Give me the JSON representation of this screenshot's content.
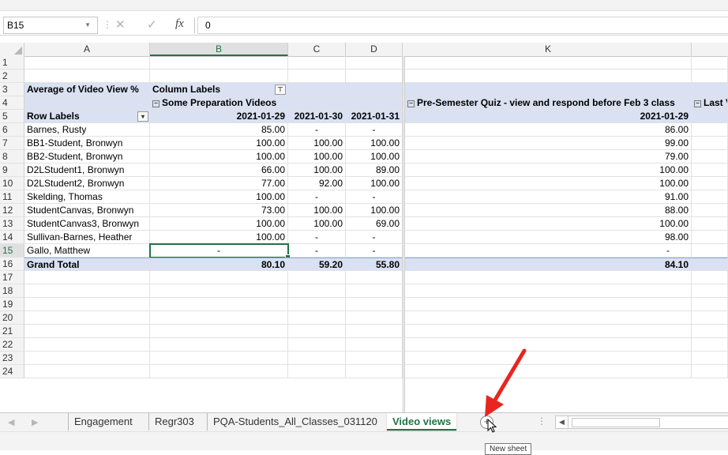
{
  "formula_bar": {
    "name_box": "B15",
    "fx_label": "fx",
    "formula_value": "0"
  },
  "columns": [
    "A",
    "B",
    "C",
    "D",
    "K"
  ],
  "row_numbers": [
    "1",
    "2",
    "3",
    "4",
    "5",
    "6",
    "7",
    "8",
    "9",
    "10",
    "11",
    "12",
    "13",
    "14",
    "15",
    "16",
    "17",
    "18",
    "19",
    "20",
    "21",
    "22",
    "23",
    "24"
  ],
  "pivot": {
    "title": "Average of Video View %",
    "column_labels": "Column Labels",
    "group1": "Some Preparation Videos",
    "group2": "Pre-Semester Quiz - view and respond before Feb 3 class",
    "group3_partial": "Last V",
    "row_labels": "Row Labels",
    "dates": [
      "2021-01-29",
      "2021-01-30",
      "2021-01-31",
      "2021-01-29"
    ],
    "rows": [
      {
        "name": "Barnes, Rusty",
        "b": "85.00",
        "c": "-",
        "d": "-",
        "k": "86.00"
      },
      {
        "name": "BB1-Student, Bronwyn",
        "b": "100.00",
        "c": "100.00",
        "d": "100.00",
        "k": "99.00"
      },
      {
        "name": "BB2-Student, Bronwyn",
        "b": "100.00",
        "c": "100.00",
        "d": "100.00",
        "k": "79.00"
      },
      {
        "name": "D2LStudent1, Bronwyn",
        "b": "66.00",
        "c": "100.00",
        "d": "89.00",
        "k": "100.00"
      },
      {
        "name": "D2LStudent2, Bronwyn",
        "b": "77.00",
        "c": "92.00",
        "d": "100.00",
        "k": "100.00"
      },
      {
        "name": "Skelding, Thomas",
        "b": "100.00",
        "c": "-",
        "d": "-",
        "k": "91.00"
      },
      {
        "name": "StudentCanvas, Bronwyn",
        "b": "73.00",
        "c": "100.00",
        "d": "100.00",
        "k": "88.00"
      },
      {
        "name": "StudentCanvas3, Bronwyn",
        "b": "100.00",
        "c": "100.00",
        "d": "69.00",
        "k": "100.00"
      },
      {
        "name": "Sullivan-Barnes, Heather",
        "b": "100.00",
        "c": "-",
        "d": "-",
        "k": "98.00"
      },
      {
        "name": "Gallo, Matthew",
        "b": "-",
        "c": "-",
        "d": "-",
        "k": "-"
      }
    ],
    "grand_total": {
      "name": "Grand Total",
      "b": "80.10",
      "c": "59.20",
      "d": "55.80",
      "k": "84.10"
    }
  },
  "sheet_tabs": [
    "Engagement",
    "Regr303",
    "PQA-Students_All_Classes_031120",
    "Video views"
  ],
  "active_tab": "Video views",
  "new_sheet_button": "+",
  "tooltip": "New sheet",
  "colors": {
    "pivot_header": "#d9e1f2",
    "excel_green": "#217346",
    "annotation_arrow": "#e8251f"
  }
}
